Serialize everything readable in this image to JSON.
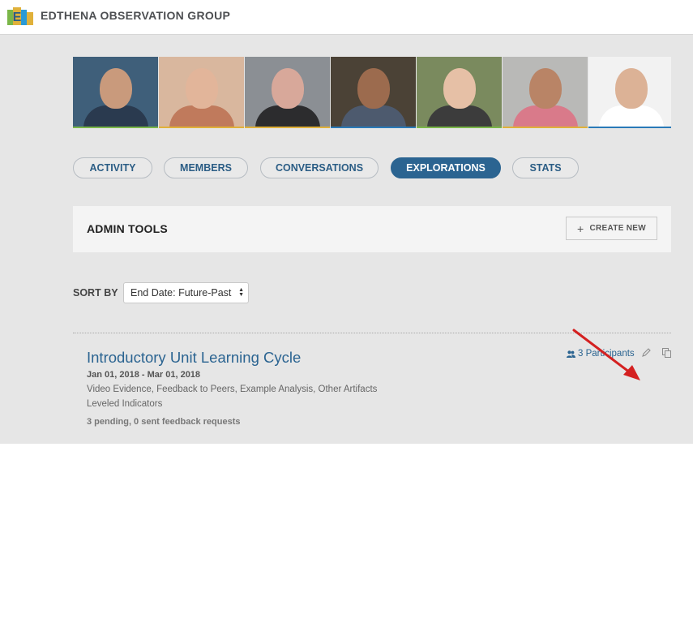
{
  "header": {
    "group_name": "EDTHENA OBSERVATION GROUP",
    "logo": "edthena-logo",
    "logo_letter": "E"
  },
  "banner": {
    "photos": [
      {
        "label": "member-photo-1",
        "bg": "#3f5f7a",
        "skin": "#c99a7c",
        "clothes": "#2a3a4f",
        "stripe": "#7ab648"
      },
      {
        "label": "member-photo-2",
        "bg": "#d9b79e",
        "skin": "#e2b59a",
        "clothes": "#c07a5c",
        "stripe": "#e0b13a"
      },
      {
        "label": "member-photo-3",
        "bg": "#8b8f94",
        "skin": "#d8a89a",
        "clothes": "#2c2c2e",
        "stripe": "#e0b13a"
      },
      {
        "label": "member-photo-4",
        "bg": "#4b4236",
        "skin": "#9c6b4e",
        "clothes": "#4d5a6e",
        "stripe": "#2a7ab8"
      },
      {
        "label": "member-photo-5",
        "bg": "#7a8a5e",
        "skin": "#e6c0a6",
        "clothes": "#3c3c3c",
        "stripe": "#7ab648"
      },
      {
        "label": "member-photo-6",
        "bg": "#b9b9b7",
        "skin": "#b98466",
        "clothes": "#d97a8a",
        "stripe": "#e0b13a"
      },
      {
        "label": "member-photo-7",
        "bg": "#f2f2f2",
        "skin": "#dcb296",
        "clothes": "#ffffff",
        "stripe": "#2a7ab8"
      }
    ]
  },
  "tabs": [
    {
      "label": "ACTIVITY",
      "active": false
    },
    {
      "label": "MEMBERS",
      "active": false
    },
    {
      "label": "CONVERSATIONS",
      "active": false
    },
    {
      "label": "EXPLORATIONS",
      "active": true
    },
    {
      "label": "STATS",
      "active": false
    }
  ],
  "admin": {
    "title": "ADMIN TOOLS",
    "create_icon": "plus-icon",
    "create_label": "CREATE NEW"
  },
  "sort": {
    "label": "SORT BY",
    "selected": "End Date: Future-Past"
  },
  "exploration": {
    "title": "Introductory Unit Learning Cycle",
    "dates": "Jan 01, 2018 - Mar 01, 2018",
    "components": "Video Evidence, Feedback to Peers, Example Analysis, Other Artifacts",
    "indicators": "Leveled Indicators",
    "pending": "3 pending, 0 sent feedback requests",
    "participants_label": "3 Participants",
    "participants_icon": "people-icon",
    "edit_icon": "pencil-icon",
    "copy_icon": "copy-icon"
  },
  "colors": {
    "accent": "#2b6491",
    "page_bg": "#e6e6e6",
    "annotation_arrow": "#d42020"
  }
}
